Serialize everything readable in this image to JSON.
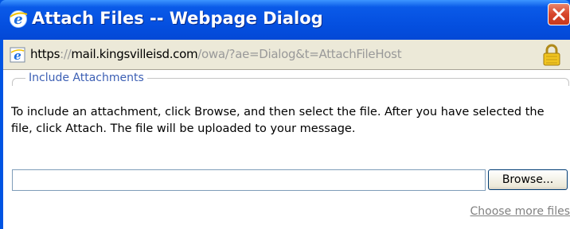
{
  "dialog": {
    "title": "Attach Files -- Webpage Dialog",
    "title_icon": "ie-icon",
    "close_icon": "close-icon"
  },
  "addressbar": {
    "icon": "ie-page-icon",
    "url_scheme": "https",
    "url_sep": "://",
    "url_host": "mail.kingsvilleisd.com",
    "url_path": "/owa/?ae=Dialog&t=AttachFileHost",
    "lock_icon": "lock-icon"
  },
  "attachments": {
    "legend": "Include Attachments",
    "instructions": "To include an attachment, click Browse, and then select the file. After you have selected the file, click Attach. The file will be uploaded to your message.",
    "file_value": "",
    "browse_label": "Browse...",
    "more_files_label": "Choose more files"
  },
  "colors": {
    "title_bar": "#0550e0",
    "legend_text": "#3c5fb4",
    "close_button": "#d7452a"
  }
}
